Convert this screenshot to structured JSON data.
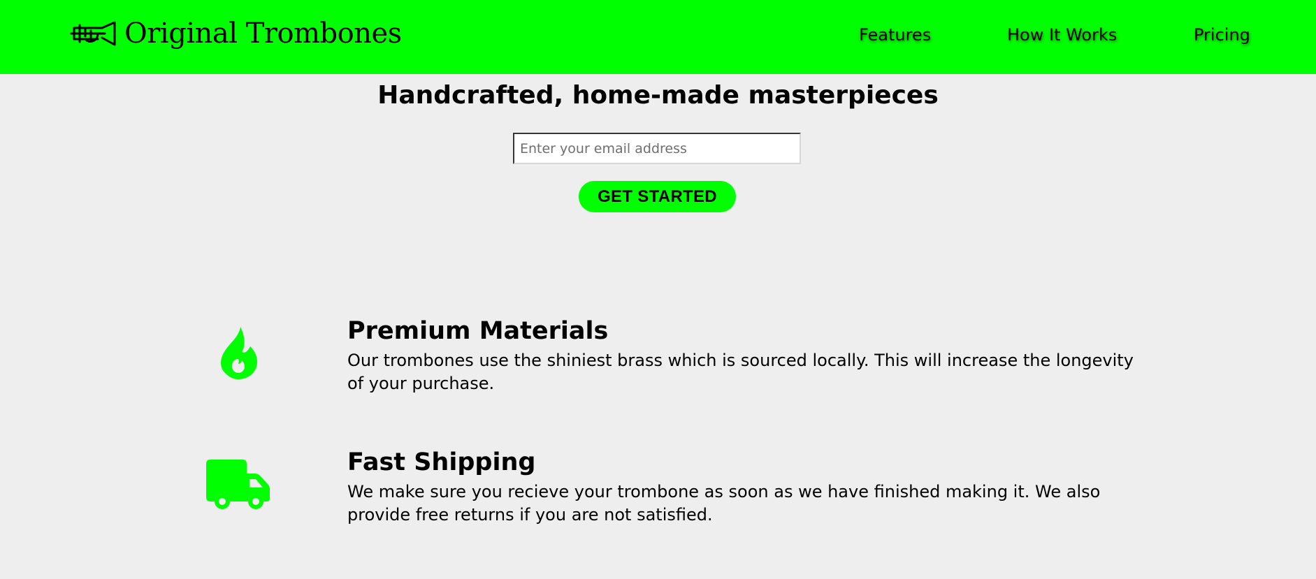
{
  "header": {
    "brand_name": "Original Trombones",
    "logo_icon": "trombone-logo-icon",
    "background_color": "#00ff00",
    "nav": {
      "features": "Features",
      "how_it_works": "How It Works",
      "pricing": "Pricing"
    }
  },
  "hero": {
    "title": "Handcrafted, home-made masterpieces",
    "email_placeholder": "Enter your email address",
    "email_value": "",
    "cta_label": "GET STARTED",
    "accent_color": "#00ff00"
  },
  "features": [
    {
      "icon": "fire-icon",
      "title": "Premium Materials",
      "text": "Our trombones use the shiniest brass which is sourced locally. This will increase the longevity of your purchase."
    },
    {
      "icon": "truck-icon",
      "title": "Fast Shipping",
      "text": "We make sure you recieve your trombone as soon as we have finished making it. We also provide free returns if you are not satisfied."
    }
  ]
}
